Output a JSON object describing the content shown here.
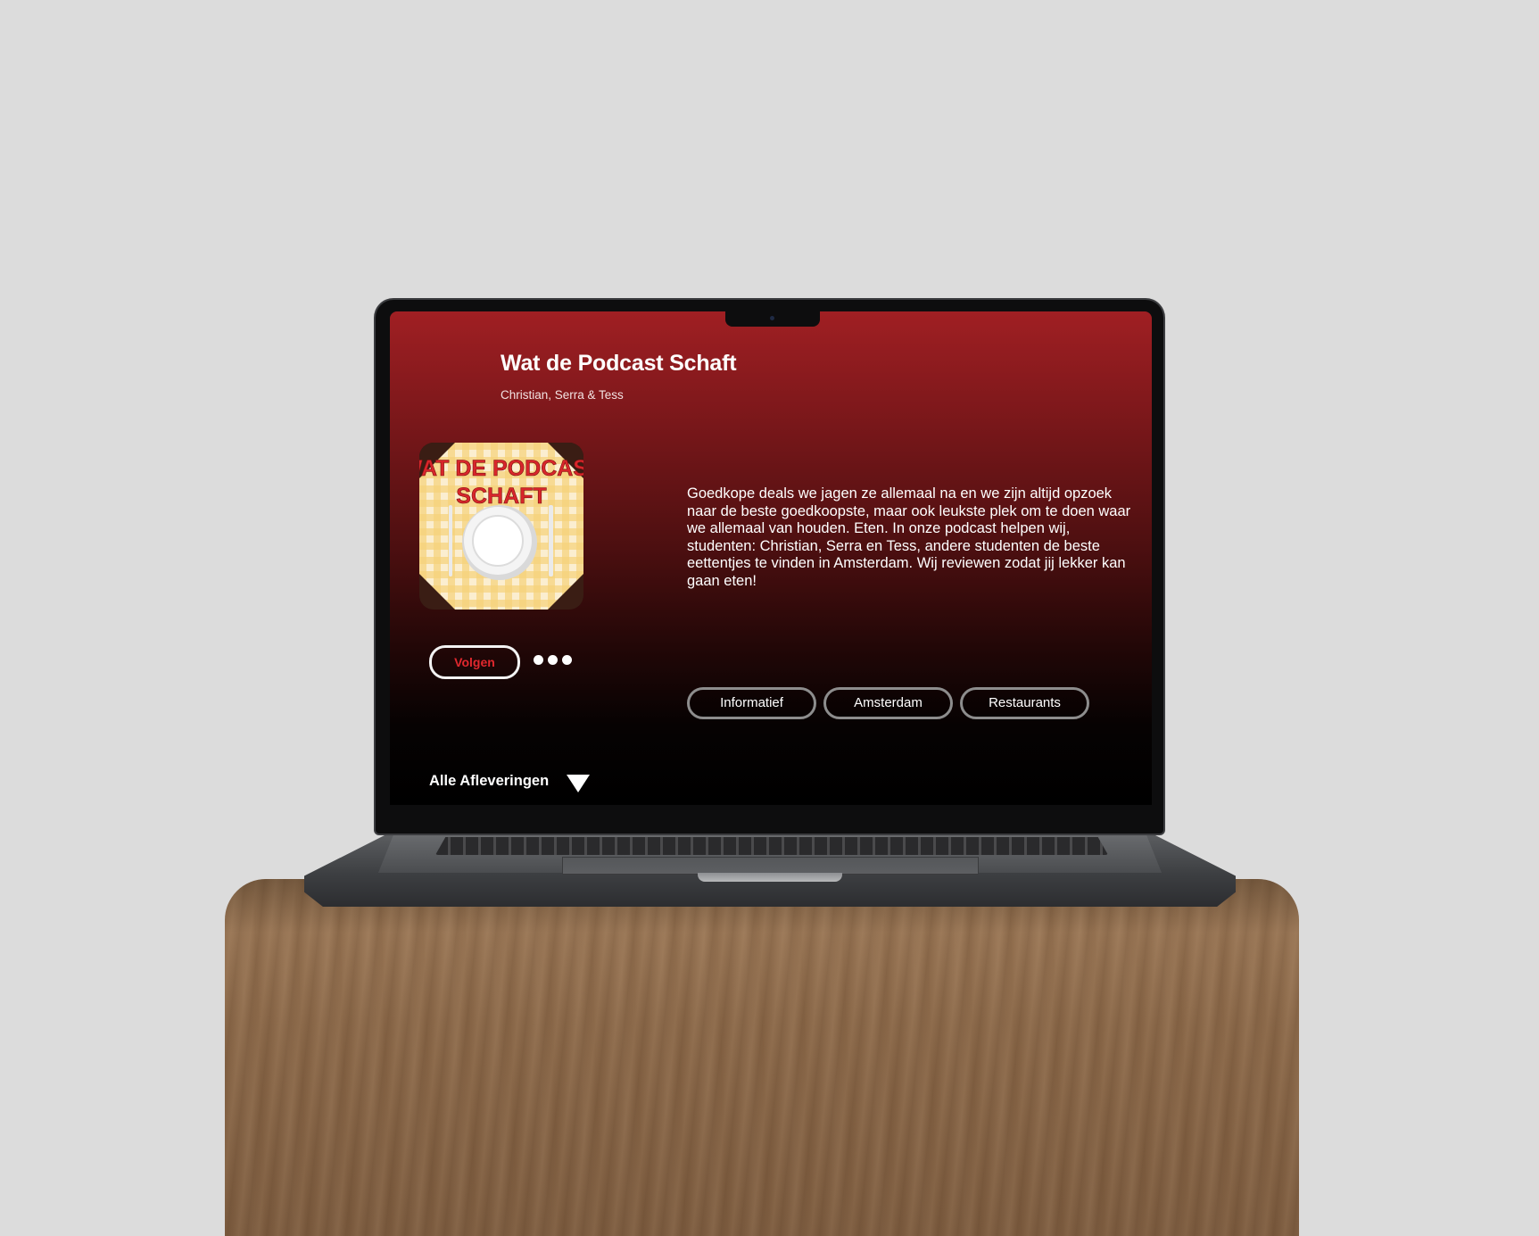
{
  "podcast": {
    "title": "Wat de Podcast Schaft",
    "hosts": "Christian, Serra & Tess",
    "cover": {
      "text_line1": "WAT DE PODCAST",
      "text_line2": "SCHAFT",
      "title_color": "#d8262b",
      "tablecloth_color": "#f5d27a"
    },
    "description": "Goedkope deals we jagen ze allemaal na en we zijn altijd opzoek naar de beste goedkoopste, maar ook leukste plek om te doen waar we allemaal van houden. Eten. In onze podcast helpen wij, studenten: Christian, Serra en Tess, andere studenten de beste eettentjes te vinden in Amsterdam. Wij reviewen zodat jij lekker kan gaan eten!"
  },
  "actions": {
    "follow_label": "Volgen",
    "more_icon": "more-dots-icon"
  },
  "tags": [
    "Informatief",
    "Amsterdam",
    "Restaurants"
  ],
  "episodes": {
    "label": "Alle Afleveringen",
    "icon": "triangle-down-icon"
  },
  "colors": {
    "accent": "#e0282e",
    "background_top": "#a01f23",
    "background_bottom": "#000000"
  }
}
